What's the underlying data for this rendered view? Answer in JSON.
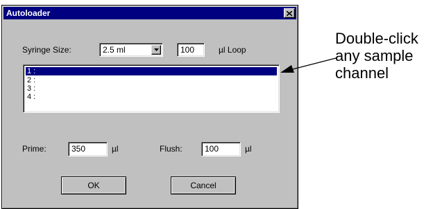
{
  "window": {
    "title": "Autoloader"
  },
  "syringe": {
    "label": "Syringe Size:",
    "size_value": "2.5 ml",
    "loop_value": "100",
    "loop_unit": "µl Loop"
  },
  "channels": [
    {
      "label": "1 :",
      "selected": true
    },
    {
      "label": "2 :",
      "selected": false
    },
    {
      "label": "3 :",
      "selected": false
    },
    {
      "label": "4 :",
      "selected": false
    }
  ],
  "prime": {
    "label": "Prime:",
    "value": "350",
    "unit": "µl"
  },
  "flush": {
    "label": "Flush:",
    "value": "100",
    "unit": "µl"
  },
  "buttons": {
    "ok": "OK",
    "cancel": "Cancel"
  },
  "annotation": {
    "lines": [
      "Double-click",
      "any sample",
      "channel"
    ]
  },
  "colors": {
    "title_bar": "#000080",
    "dialog_face": "#c0c0c0",
    "selection": "#000080"
  },
  "icons": {
    "close": "close-icon",
    "dropdown": "chevron-down-icon",
    "pointer": "arrow-icon"
  }
}
